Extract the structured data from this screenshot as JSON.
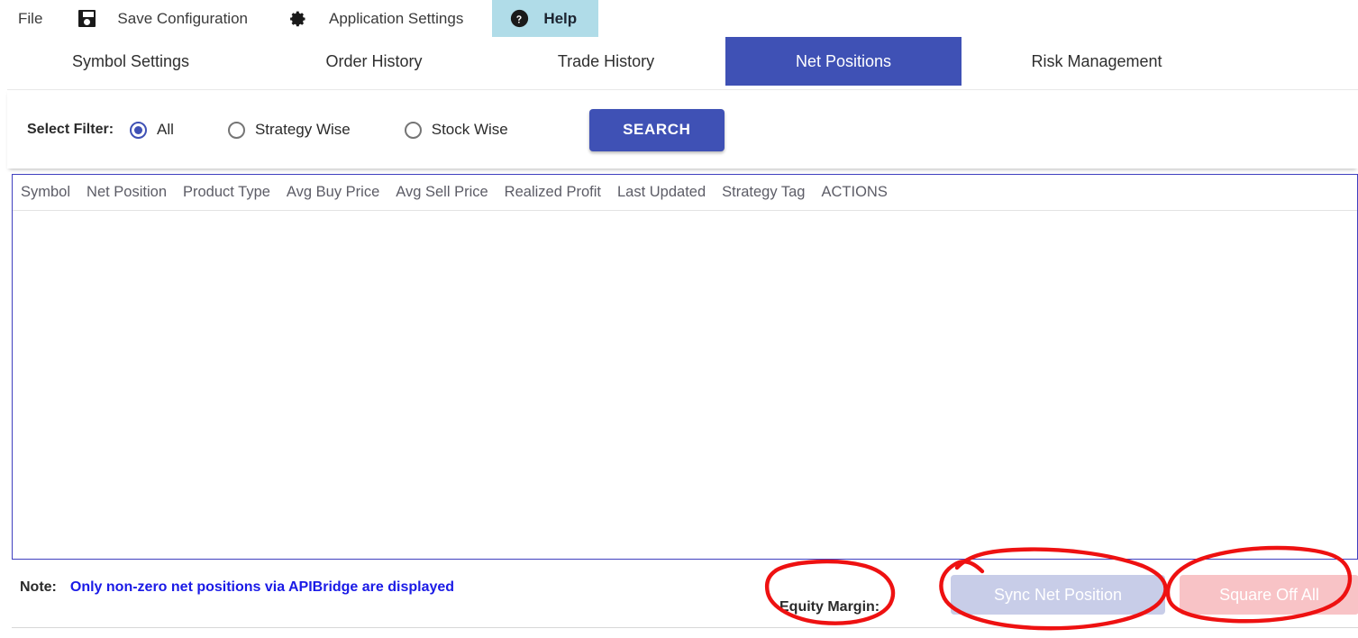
{
  "menubar": {
    "items": [
      {
        "label": "File",
        "icon": null
      },
      {
        "label": "Save Configuration",
        "icon": "save-icon"
      },
      {
        "label": "Application Settings",
        "icon": "gear-icon"
      },
      {
        "label": "Help",
        "icon": "help-circle-icon"
      }
    ],
    "file_label": "File",
    "save_label": "Save Configuration",
    "settings_label": "Application Settings",
    "help_label": "Help",
    "help_highlight_color": "#b0dce8"
  },
  "tabs": {
    "active": "Net Positions",
    "active_color": "#3f51b5",
    "items": [
      {
        "label": "Symbol Settings"
      },
      {
        "label": "Order History"
      },
      {
        "label": "Trade History"
      },
      {
        "label": "Net Positions"
      },
      {
        "label": "Risk Management"
      }
    ]
  },
  "filter": {
    "label": "Select Filter:",
    "options": [
      {
        "label": "All",
        "selected": true
      },
      {
        "label": "Strategy Wise",
        "selected": false
      },
      {
        "label": "Stock Wise",
        "selected": false
      }
    ],
    "search_label": "SEARCH",
    "search_color": "#3f51b5"
  },
  "table": {
    "columns": [
      "Symbol",
      "Net Position",
      "Product Type",
      "Avg Buy Price",
      "Avg Sell Price",
      "Realized Profit",
      "Last Updated",
      "Strategy Tag",
      "ACTIONS"
    ],
    "rows": [],
    "border_color": "#3f3fbf"
  },
  "footer": {
    "note_label": "Note:",
    "note_text": "Only non-zero net positions via APIBridge are displayed",
    "note_color": "#1a1ae6",
    "equity_label": "Equity Margin:",
    "equity_value": "",
    "sync_label": "Sync Net Position",
    "sync_color": "#c8cde8",
    "square_off_label": "Square Off All",
    "square_off_color": "#f8c3c6"
  },
  "annotations": {
    "color": "#ee1111",
    "shapes": [
      {
        "name": "circle-around-equity-margin"
      },
      {
        "name": "circle-around-sync-net-position"
      },
      {
        "name": "circle-around-square-off-all"
      }
    ]
  }
}
